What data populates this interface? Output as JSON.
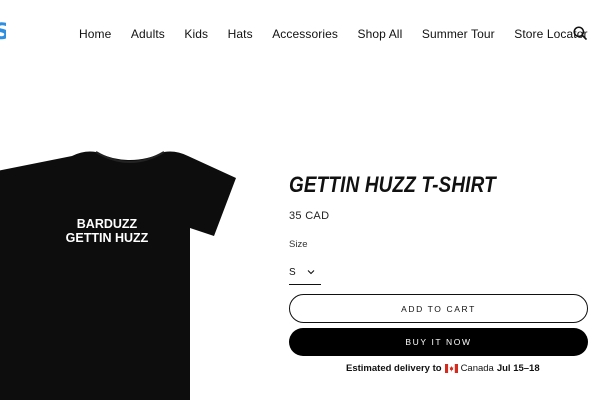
{
  "header": {
    "nav": [
      {
        "label": "Home"
      },
      {
        "label": "Adults"
      },
      {
        "label": "Kids"
      },
      {
        "label": "Hats"
      },
      {
        "label": "Accessories"
      },
      {
        "label": "Shop All"
      },
      {
        "label": "Summer Tour"
      },
      {
        "label": "Store Locator"
      }
    ],
    "search_icon": "search-icon",
    "logo_color": "#2e8fe0"
  },
  "product": {
    "title": "GETTIN HUZZ T-SHIRT",
    "price": "35 CAD",
    "size_label": "Size",
    "size_value": "S",
    "add_to_cart": "ADD TO CART",
    "buy_now": "BUY IT NOW",
    "image_text_line1": "BARDUZZ",
    "image_text_line2": "GETTIN HUZZ",
    "shirt_color": "#0d0d0d"
  },
  "delivery": {
    "prefix": "Estimated delivery to",
    "flag_icon": "canada-flag-icon",
    "country": "Canada",
    "dates": "Jul 15–18"
  }
}
